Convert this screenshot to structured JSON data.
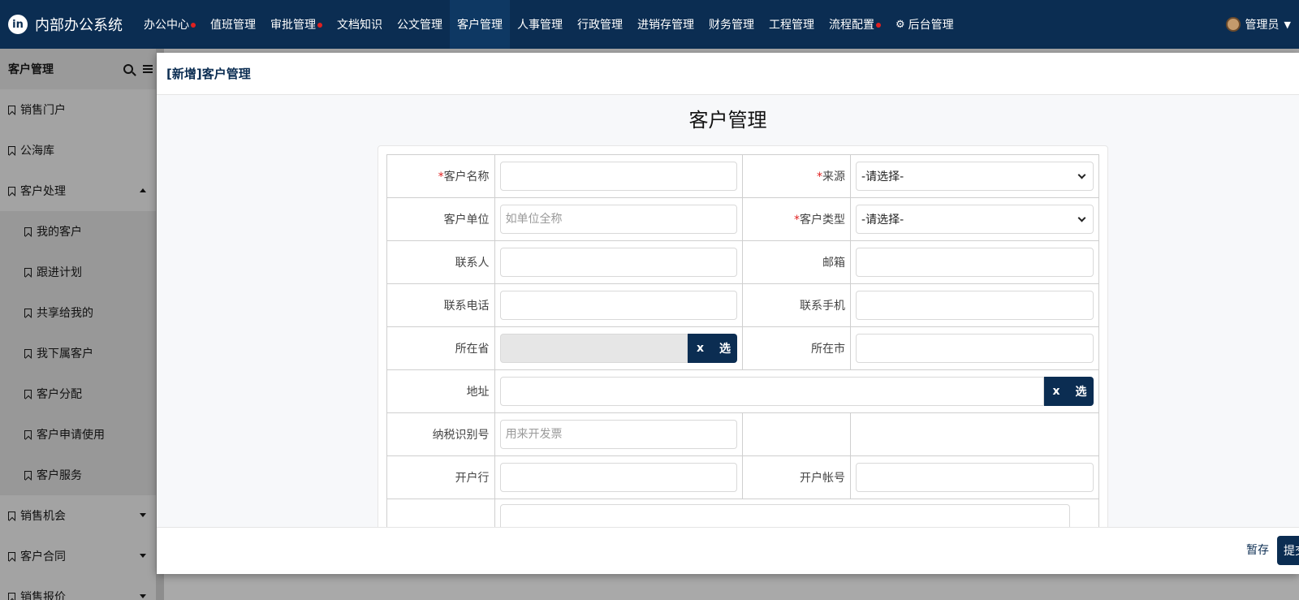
{
  "app": {
    "logo_mark": "in",
    "title": "内部办公系统"
  },
  "topnav": [
    {
      "label": "办公中心",
      "dot": true
    },
    {
      "label": "值班管理",
      "dot": false
    },
    {
      "label": "审批管理",
      "dot": true
    },
    {
      "label": "文档知识",
      "dot": false
    },
    {
      "label": "公文管理",
      "dot": false
    },
    {
      "label": "客户管理",
      "dot": false,
      "active": true
    },
    {
      "label": "人事管理",
      "dot": false
    },
    {
      "label": "行政管理",
      "dot": false
    },
    {
      "label": "进销存管理",
      "dot": false
    },
    {
      "label": "财务管理",
      "dot": false
    },
    {
      "label": "工程管理",
      "dot": false
    },
    {
      "label": "流程配置",
      "dot": true
    },
    {
      "label": "后台管理",
      "dot": false,
      "icon": "gear-icon"
    }
  ],
  "user": {
    "name": "管理员"
  },
  "sidebar": {
    "title": "客户管理",
    "items": [
      {
        "label": "销售门户"
      },
      {
        "label": "公海库"
      },
      {
        "label": "客户处理",
        "expanded": true
      },
      {
        "label": "我的客户",
        "sub": true
      },
      {
        "label": "跟进计划",
        "sub": true
      },
      {
        "label": "共享给我的",
        "sub": true
      },
      {
        "label": "我下属客户",
        "sub": true
      },
      {
        "label": "客户分配",
        "sub": true
      },
      {
        "label": "客户申请使用",
        "sub": true
      },
      {
        "label": "客户服务",
        "sub": true
      },
      {
        "label": "销售机会",
        "collapsed": true
      },
      {
        "label": "客户合同",
        "collapsed": true
      },
      {
        "label": "销售报价",
        "collapsed": true
      }
    ]
  },
  "modal": {
    "title": "[新增]客户管理",
    "form_title": "客户管理",
    "required_mark": "*",
    "fields": {
      "customer_name": {
        "label": "客户名称",
        "value": ""
      },
      "source": {
        "label": "来源",
        "selected": "-请选择-"
      },
      "customer_unit": {
        "label": "客户单位",
        "placeholder": "如单位全称"
      },
      "customer_type": {
        "label": "客户类型",
        "selected": "-请选择-"
      },
      "contact": {
        "label": "联系人",
        "value": ""
      },
      "email": {
        "label": "邮箱",
        "value": ""
      },
      "phone": {
        "label": "联系电话",
        "value": ""
      },
      "mobile": {
        "label": "联系手机",
        "value": ""
      },
      "province": {
        "label": "所在省",
        "clear": "x",
        "pick": "选"
      },
      "city": {
        "label": "所在市",
        "value": ""
      },
      "address": {
        "label": "地址",
        "clear": "x",
        "pick": "选"
      },
      "tax_id": {
        "label": "纳税识别号",
        "placeholder": "用来开发票"
      },
      "bank": {
        "label": "开户行",
        "value": ""
      },
      "bank_account": {
        "label": "开户帐号",
        "value": ""
      }
    },
    "footer": {
      "save_draft": "暂存",
      "submit": "提交"
    }
  }
}
